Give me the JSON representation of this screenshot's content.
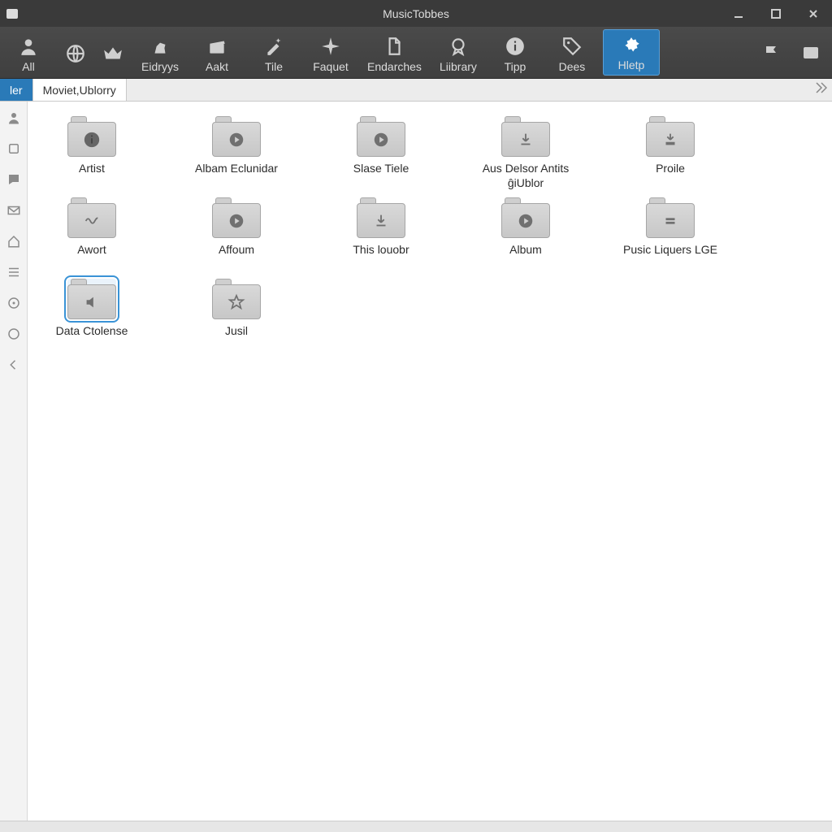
{
  "window": {
    "title": "MusicTobbes"
  },
  "toolbar": {
    "items": [
      {
        "label": "All",
        "icon": "person"
      },
      {
        "label": "",
        "icon": "globe"
      },
      {
        "label": "",
        "icon": "crown"
      },
      {
        "label": "Eidryys",
        "icon": "horse"
      },
      {
        "label": "Aakt",
        "icon": "clapper"
      },
      {
        "label": "Tile",
        "icon": "pencil-star"
      },
      {
        "label": "Faquet",
        "icon": "star4"
      },
      {
        "label": "Endarches",
        "icon": "doc"
      },
      {
        "label": "Liibrary",
        "icon": "badge"
      },
      {
        "label": "Tipp",
        "icon": "info"
      },
      {
        "label": "Dees",
        "icon": "tag"
      },
      {
        "label": "Hletp",
        "icon": "gear",
        "active": true
      }
    ]
  },
  "tabs": [
    {
      "label": "ler",
      "active": true
    },
    {
      "label": "Moviet,Ublorry",
      "active": false
    }
  ],
  "sidebar_icons": [
    "person",
    "square",
    "chat",
    "mail",
    "home",
    "list",
    "disc",
    "globe2",
    "back"
  ],
  "folders": [
    {
      "label": "Artist",
      "glyph": "info",
      "selected": false
    },
    {
      "label": "Albam Eclunidar",
      "glyph": "play",
      "selected": false
    },
    {
      "label": "Slase Tiele",
      "glyph": "play",
      "selected": false
    },
    {
      "label": "Aus Delsor Antits ĝiUblor",
      "glyph": "download",
      "selected": false
    },
    {
      "label": "Proile",
      "glyph": "download-bar",
      "selected": false
    },
    {
      "label": "Awort",
      "glyph": "wave",
      "selected": false
    },
    {
      "label": "Affoum",
      "glyph": "play",
      "selected": false
    },
    {
      "label": "This louobr",
      "glyph": "download",
      "selected": false
    },
    {
      "label": "Album",
      "glyph": "play",
      "selected": false
    },
    {
      "label": "Pusic Liquers LGE",
      "glyph": "equals",
      "selected": false
    },
    {
      "label": "Data Ctolense",
      "glyph": "speaker",
      "selected": true
    },
    {
      "label": "Jusil",
      "glyph": "star",
      "selected": false
    }
  ]
}
